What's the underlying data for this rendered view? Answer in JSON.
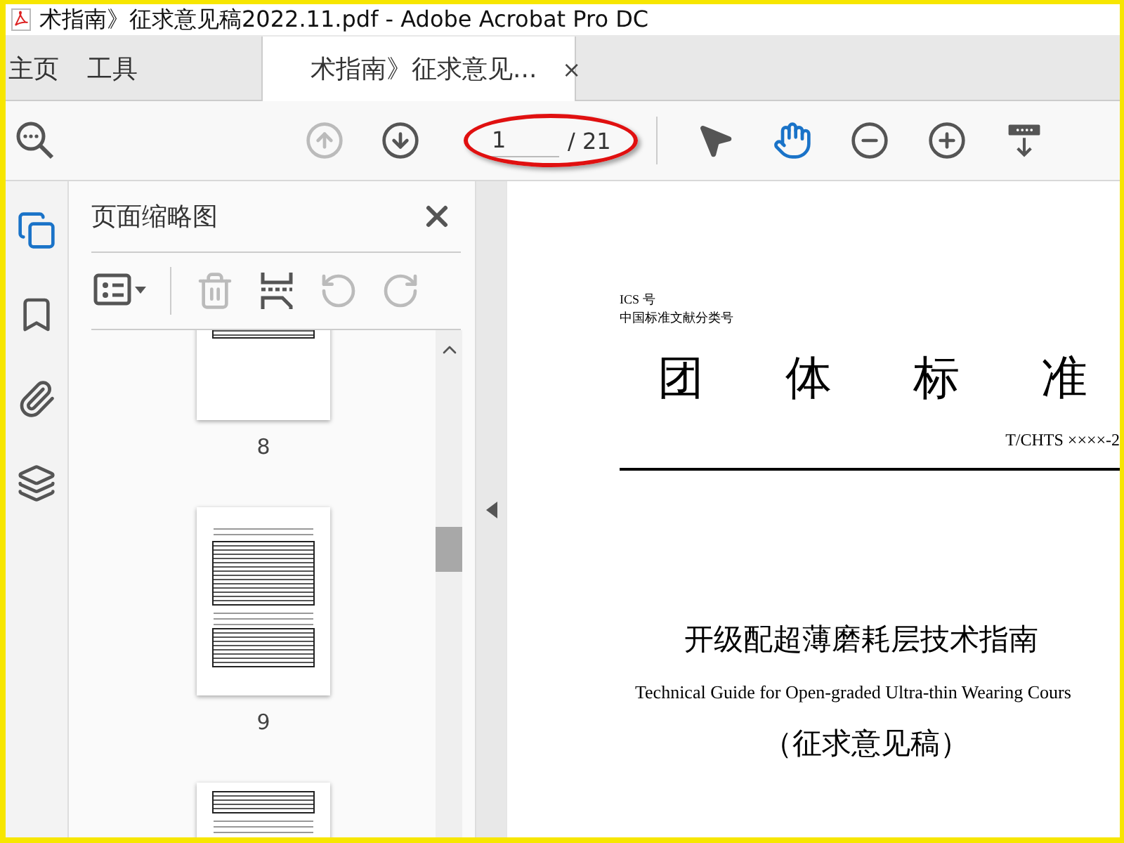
{
  "window": {
    "title": "术指南》征求意见稿2022.11.pdf - Adobe Acrobat Pro DC"
  },
  "tabs": [
    {
      "label": "主页",
      "selected": false
    },
    {
      "label": "工具",
      "selected": false
    },
    {
      "label": "术指南》征求意见...",
      "selected": true,
      "close_glyph": "×"
    }
  ],
  "toolbar": {
    "navigation": [
      {
        "kind": "prev",
        "disabled": true
      },
      {
        "kind": "next",
        "disabled": false
      }
    ],
    "page_current": "1",
    "page_total": "/ 21",
    "highlighted": true,
    "tools": [
      {
        "kind": "select",
        "selected": false
      },
      {
        "kind": "hand",
        "selected": true
      },
      {
        "kind": "zoom-out",
        "selected": false
      },
      {
        "kind": "zoom-in",
        "selected": false
      },
      {
        "kind": "keyboard",
        "selected": false
      }
    ]
  },
  "sidebar": {
    "rail": [
      {
        "kind": "pages",
        "selected": true
      },
      {
        "kind": "bookmarks",
        "selected": false
      },
      {
        "kind": "attachments",
        "selected": false
      },
      {
        "kind": "layers",
        "selected": false
      }
    ]
  },
  "thumbnail_panel": {
    "title": "页面缩略图",
    "tools": [
      {
        "kind": "options",
        "disabled": false
      },
      {
        "kind": "delete",
        "disabled": true
      },
      {
        "kind": "insert",
        "disabled": false
      },
      {
        "kind": "rotate-left",
        "disabled": true
      },
      {
        "kind": "rotate-right",
        "disabled": true
      }
    ],
    "thumbnails": [
      {
        "kind": "cut-top",
        "label": "8"
      },
      {
        "kind": "full",
        "label": "9"
      },
      {
        "kind": "cut-bottom"
      }
    ]
  },
  "document": {
    "ics": "ICS 号",
    "ccs": "中国标准文献分类号",
    "banner": [
      "团",
      "体",
      "标",
      "准"
    ],
    "code": "T/CHTS ××××-2",
    "title_cn": "开级配超薄磨耗层技术指南",
    "title_en": "Technical Guide for Open-graded Ultra-thin Wearing Cours",
    "status": "（征求意见稿）"
  }
}
